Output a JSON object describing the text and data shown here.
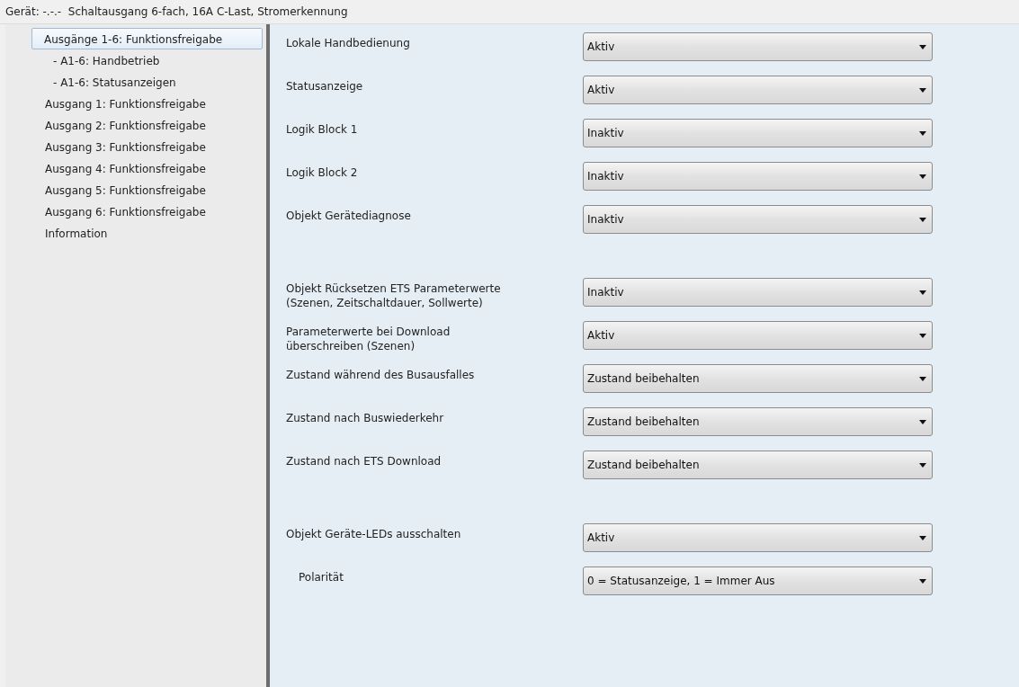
{
  "window": {
    "title": "Gerät: -.-.-  Schaltausgang 6-fach, 16A C-Last, Stromerkennung"
  },
  "sidebar": {
    "items": [
      {
        "label": "Ausgänge 1-6: Funktionsfreigabe",
        "selected": true,
        "children": [
          {
            "label": "- A1-6: Handbetrieb",
            "selected": false
          },
          {
            "label": "- A1-6: Statusanzeigen",
            "selected": false
          }
        ]
      },
      {
        "label": "Ausgang 1: Funktionsfreigabe",
        "selected": false
      },
      {
        "label": "Ausgang 2: Funktionsfreigabe",
        "selected": false
      },
      {
        "label": "Ausgang 3: Funktionsfreigabe",
        "selected": false
      },
      {
        "label": "Ausgang 4: Funktionsfreigabe",
        "selected": false
      },
      {
        "label": "Ausgang 5: Funktionsfreigabe",
        "selected": false
      },
      {
        "label": "Ausgang 6: Funktionsfreigabe",
        "selected": false
      },
      {
        "label": "Information",
        "selected": false
      }
    ]
  },
  "groups": [
    {
      "settings": [
        {
          "label": "Lokale Handbedienung",
          "value": "Aktiv"
        },
        {
          "label": "Statusanzeige",
          "value": "Aktiv"
        },
        {
          "label": "Logik Block 1",
          "value": "Inaktiv"
        },
        {
          "label": "Logik Block 2",
          "value": "Inaktiv"
        },
        {
          "label": "Objekt Gerätediagnose",
          "value": "Inaktiv"
        }
      ]
    },
    {
      "settings": [
        {
          "label": "Objekt Rücksetzen ETS Parameterwerte\n(Szenen, Zeitschaltdauer, Sollwerte)",
          "value": "Inaktiv"
        },
        {
          "label": "Parameterwerte bei Download\nüberschreiben (Szenen)",
          "value": "Aktiv"
        },
        {
          "label": "Zustand während des Busausfalles",
          "value": "Zustand beibehalten"
        },
        {
          "label": "Zustand nach Buswiederkehr",
          "value": "Zustand beibehalten"
        },
        {
          "label": "Zustand nach ETS Download",
          "value": "Zustand beibehalten"
        }
      ]
    },
    {
      "settings": [
        {
          "label": "Objekt Geräte-LEDs ausschalten",
          "value": "Aktiv",
          "children": [
            {
              "label": "Polarität",
              "value": "0 = Statusanzeige, 1 = Immer Aus"
            }
          ]
        }
      ]
    }
  ]
}
